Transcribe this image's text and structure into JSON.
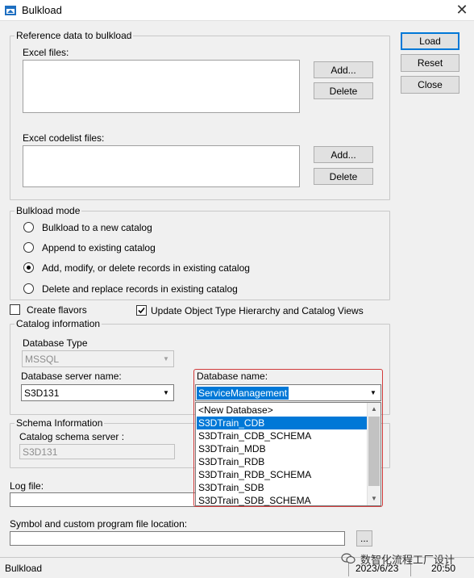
{
  "window": {
    "title": "Bulkload",
    "close_glyph": "✕"
  },
  "side_buttons": {
    "load": "Load",
    "reset": "Reset",
    "close": "Close"
  },
  "reference_group": {
    "legend": "Reference data to bulkload",
    "excel_files_label": "Excel files:",
    "excel_codelist_label": "Excel codelist files:",
    "add_label": "Add...",
    "delete_label": "Delete"
  },
  "bulkload_mode": {
    "legend": "Bulkload mode",
    "options": [
      {
        "label": "Bulkload to a new catalog",
        "checked": false
      },
      {
        "label": "Append to existing  catalog",
        "checked": false
      },
      {
        "label": "Add, modify, or delete records in existing catalog",
        "checked": true
      },
      {
        "label": "Delete and replace records in existing catalog",
        "checked": false
      }
    ]
  },
  "checkboxes": {
    "create_flavors": {
      "label": "Create flavors",
      "checked": false
    },
    "update_hierarchy": {
      "label": "Update Object Type Hierarchy and Catalog Views",
      "checked": true
    }
  },
  "catalog_info": {
    "legend": "Catalog information",
    "db_type_label": "Database Type",
    "db_type_value": "MSSQL",
    "server_label": "Database server name:",
    "server_value": "S3D131",
    "db_name_label": "Database name:",
    "db_name_value": "ServiceManagement",
    "db_name_options": [
      "<New Database>",
      "S3DTrain_CDB",
      "S3DTrain_CDB_SCHEMA",
      "S3DTrain_MDB",
      "S3DTrain_RDB",
      "S3DTrain_RDB_SCHEMA",
      "S3DTrain_SDB",
      "S3DTrain_SDB_SCHEMA"
    ],
    "highlighted_option_index": 2
  },
  "schema_info": {
    "legend": "Schema Information",
    "schema_server_label": "Catalog schema server :",
    "schema_server_value": "S3D131"
  },
  "log_file": {
    "label": "Log file:",
    "value": ""
  },
  "symbol_location": {
    "label": "Symbol and custom program file location:",
    "value": "",
    "browse_label": "..."
  },
  "status_bar": {
    "app_name": "Bulkload",
    "date": "2023/6/23",
    "time": "20:50"
  },
  "watermark": {
    "text": "数智化流程工厂设计"
  },
  "colors": {
    "selection": "#0078d7",
    "highlight_border": "#d23b3b",
    "background": "#f0f0f0"
  }
}
